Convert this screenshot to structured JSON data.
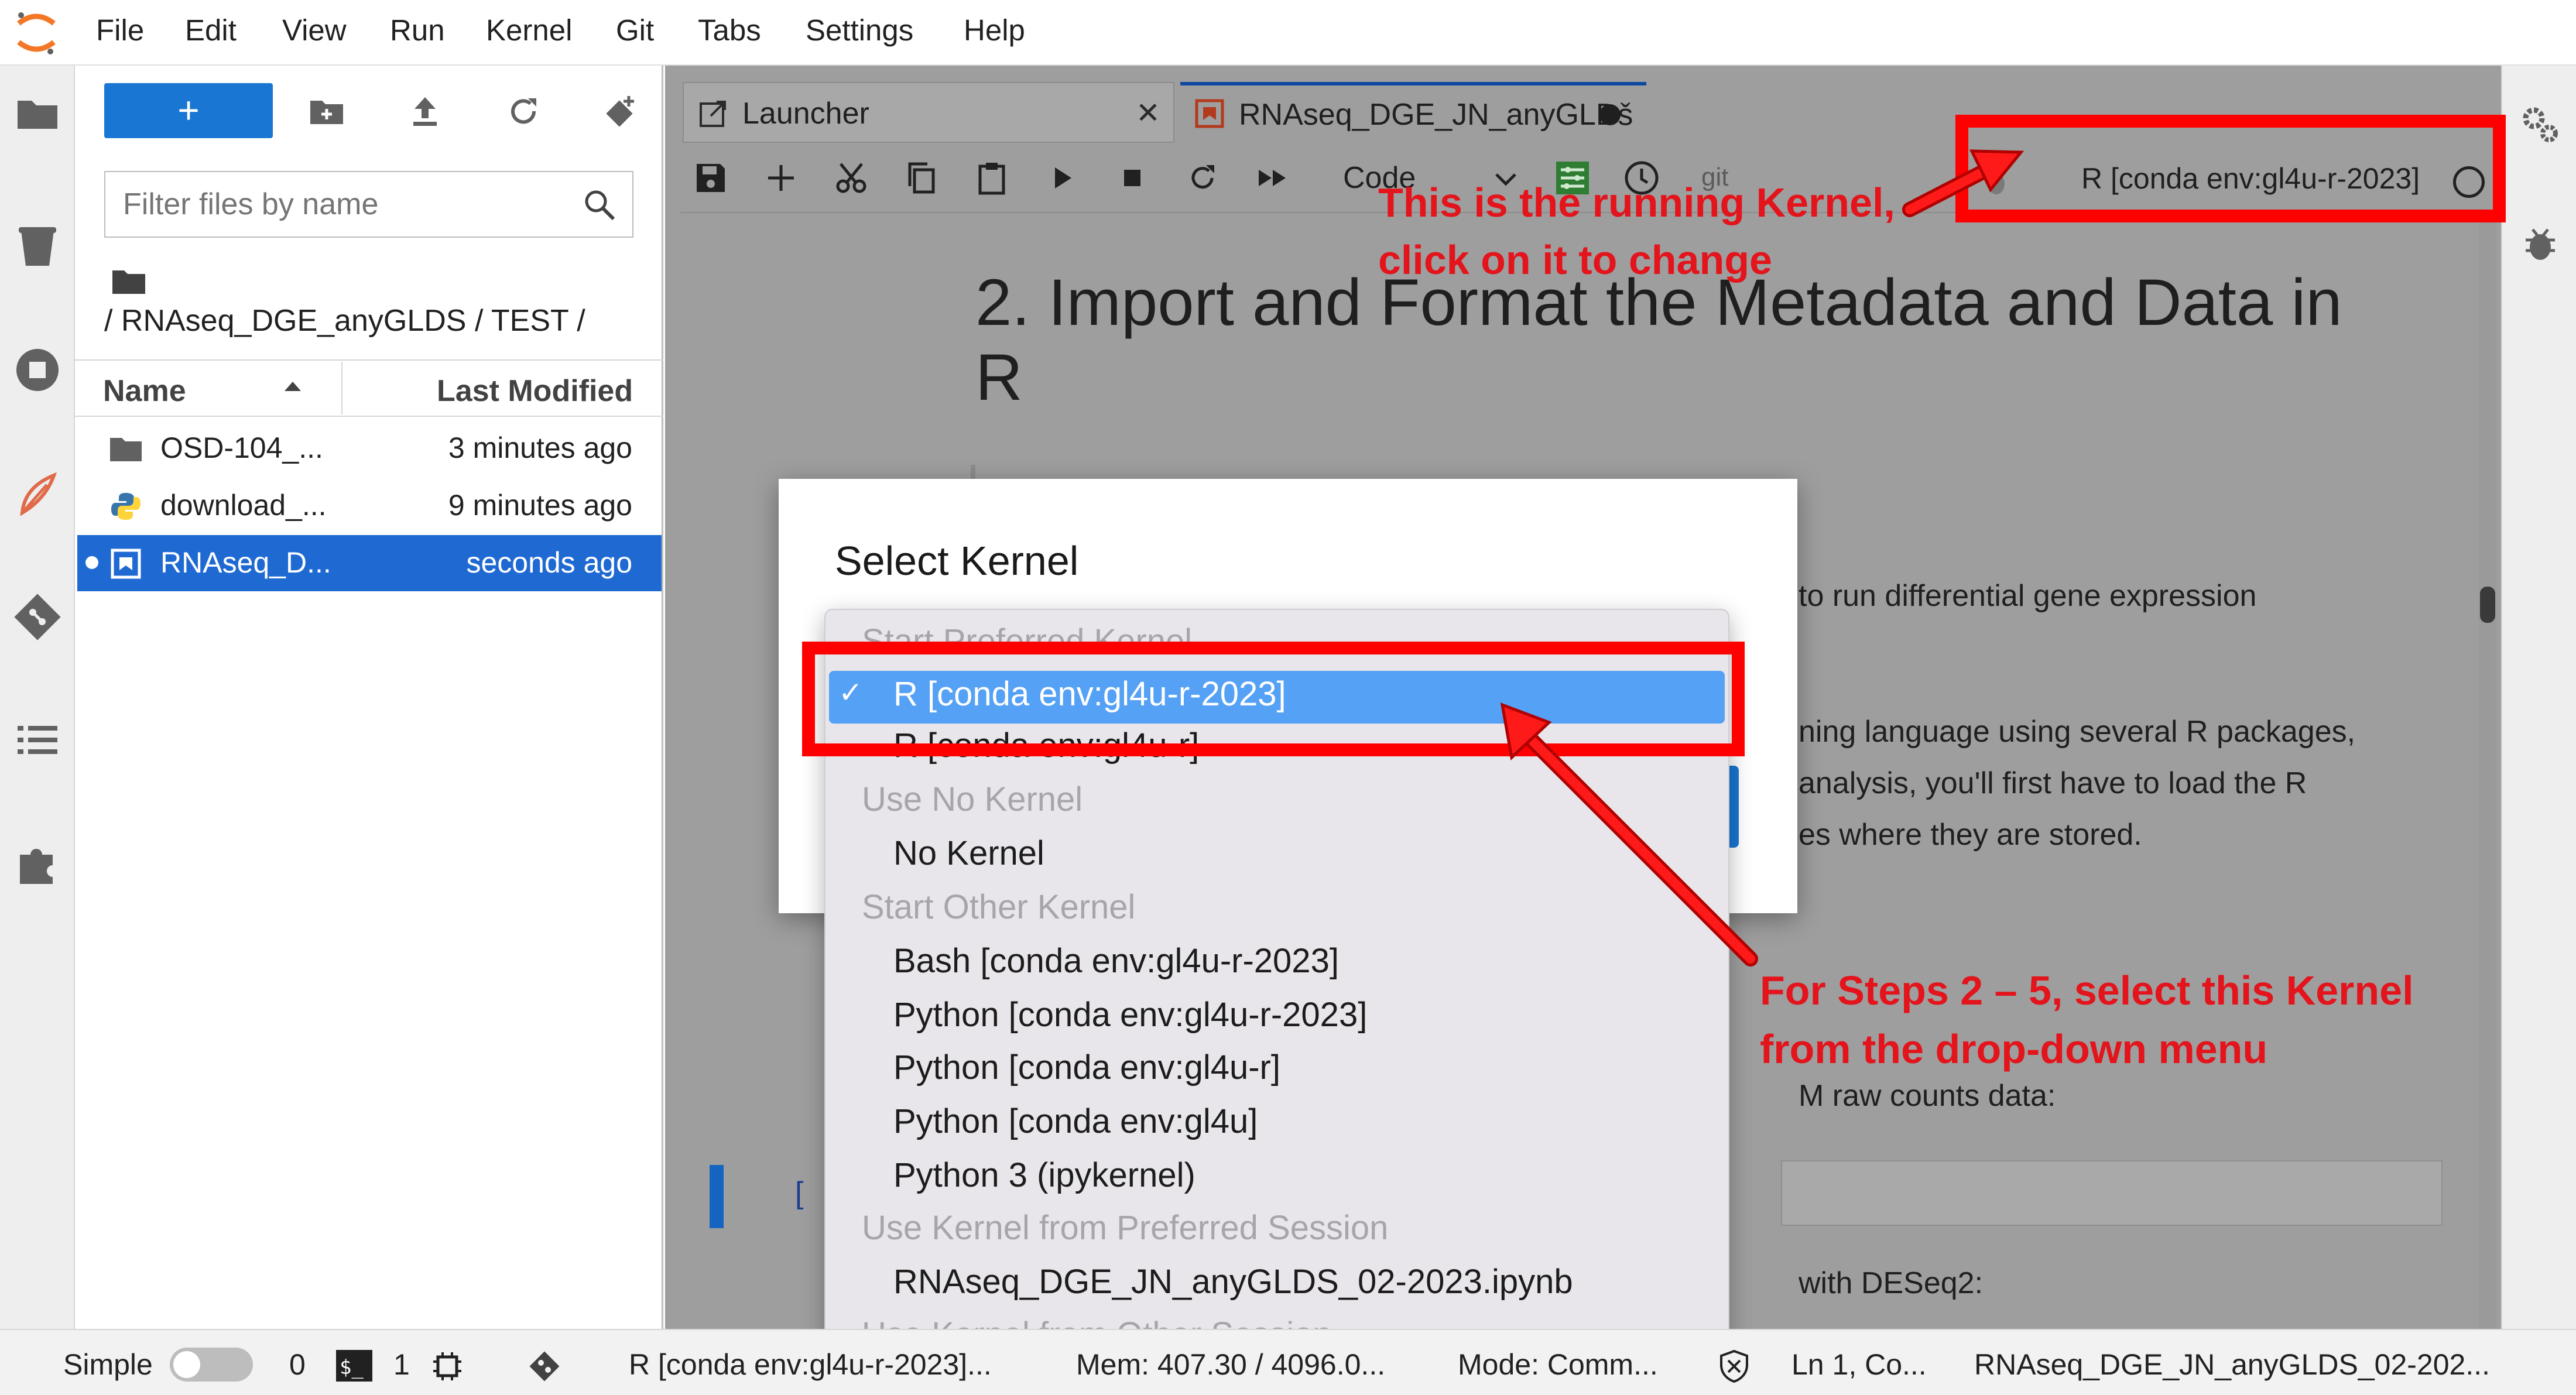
{
  "menubar": {
    "items": [
      "File",
      "Edit",
      "View",
      "Run",
      "Kernel",
      "Git",
      "Tabs",
      "Settings",
      "Help"
    ]
  },
  "activity_bar": {
    "icons": [
      "folder-icon",
      "running-icon",
      "stop-icon",
      "fleck-icon",
      "git-icon",
      "toc-icon",
      "extension-icon"
    ]
  },
  "file_browser": {
    "new_label": "+",
    "filter_placeholder": "Filter files by name",
    "breadcrumb": "/ RNAseq_DGE_anyGLDS / TEST /",
    "columns": {
      "name": "Name",
      "modified": "Last Modified"
    },
    "rows": [
      {
        "name": "OSD-104_...",
        "modified": "3 minutes ago",
        "icon": "folder-icon"
      },
      {
        "name": "download_...",
        "modified": "9 minutes ago",
        "icon": "python-icon"
      },
      {
        "name": "RNAseq_D...",
        "modified": "seconds ago",
        "icon": "notebook-icon"
      }
    ]
  },
  "tabs": [
    {
      "label": "Launcher",
      "close": "✕"
    },
    {
      "label": "RNAseq_DGE_JN_anyGLDš"
    }
  ],
  "toolbar": {
    "cell_type": "Code",
    "git_label": "git",
    "kernel_name": "R [conda env:gl4u-r-2023]"
  },
  "notebook": {
    "heading_line1": "2. Import and Format the Metadata and Data in",
    "heading_line2": "R",
    "text_1": "to run differential gene expression",
    "text_2": "ning language using several R packages,",
    "text_3": "analysis, you'll first have to load the R",
    "text_4": "es where they are stored.",
    "text_5": "M raw counts data:",
    "text_6": "with DESeq2:",
    "cell_prompt": "["
  },
  "dialog": {
    "title": "Select Kernel",
    "dropdown": {
      "items": [
        {
          "type": "group",
          "label": "Start Preferred Kernel"
        },
        {
          "type": "option",
          "label": "R [conda env:gl4u-r-2023]",
          "selected": true,
          "check": "✓"
        },
        {
          "type": "option",
          "label": "R [conda env:gl4u-r]"
        },
        {
          "type": "group",
          "label": "Use No Kernel"
        },
        {
          "type": "option",
          "label": "No Kernel"
        },
        {
          "type": "group",
          "label": "Start Other Kernel"
        },
        {
          "type": "option",
          "label": "Bash [conda env:gl4u-r-2023]"
        },
        {
          "type": "option",
          "label": "Python [conda env:gl4u-r-2023]"
        },
        {
          "type": "option",
          "label": "Python [conda env:gl4u-r]"
        },
        {
          "type": "option",
          "label": "Python [conda env:gl4u]"
        },
        {
          "type": "option",
          "label": "Python 3 (ipykernel)"
        },
        {
          "type": "group",
          "label": "Use Kernel from Preferred Session"
        },
        {
          "type": "option",
          "label": "RNAseq_DGE_JN_anyGLDS_02-2023.ipynb"
        },
        {
          "type": "group",
          "label": "Use Kernel from Other Session"
        }
      ]
    }
  },
  "annotations": {
    "kernel_note_line1": "This is the running Kernel,",
    "kernel_note_line2": "click on it to change",
    "select_note_line1": "For Steps 2 – 5, select this Kernel",
    "select_note_line2": "from the drop-down menu"
  },
  "statusbar": {
    "mode": "Simple",
    "terminals": "0",
    "kernels": "1",
    "kernel_status": "R [conda env:gl4u-r-2023]...",
    "memory": "Mem: 407.30 / 4096.0...",
    "mode_text": "Mode: Comm...",
    "cursor": "Ln 1, Co...",
    "filename": "RNAseq_DGE_JN_anyGLDS_02-202..."
  },
  "colors": {
    "accent_blue": "#1976d2",
    "selected_row": "#1f6ad2",
    "dropdown_highlight": "#55a1f5",
    "annotation_red": "#e3141b",
    "highlight_box": "#ff0000"
  }
}
